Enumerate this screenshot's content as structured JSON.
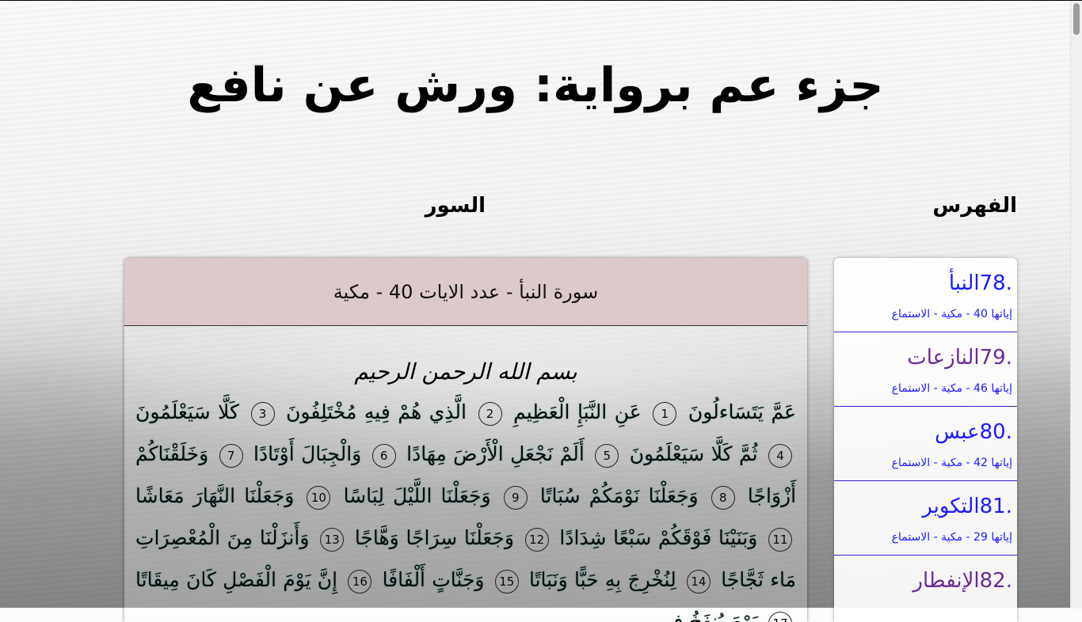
{
  "page": {
    "title": "جزء عم برواية: ورش عن نافع"
  },
  "headings": {
    "index": "الفهرس",
    "surahs": "السور"
  },
  "index": {
    "items": [
      {
        "title": ".78النبأ",
        "meta": "إياتها 40 - مكية - الاستماع",
        "visited": false
      },
      {
        "title": ".79النازعات",
        "meta": "إياتها 46 - مكية - الاستماع",
        "visited": true
      },
      {
        "title": ".80عبس",
        "meta": "إياتها 42 - مكية - الاستماع",
        "visited": false
      },
      {
        "title": ".81التكوير",
        "meta": "إياتها 29 - مكية - الاستماع",
        "visited": false
      },
      {
        "title": ".82الإنفطار",
        "meta": "",
        "visited": true
      }
    ]
  },
  "surah": {
    "header": "سورة النبأ - عدد الايات 40 - مكية",
    "basmala": "بسم الله الرحمن الرحيم",
    "verses": [
      {
        "text": "عَمَّ يَتَسَاءلُونَ",
        "num": "1"
      },
      {
        "text": "عَنِ النَّبَإِ الْعَظِيمِ",
        "num": "2"
      },
      {
        "text": "الَّذِي هُمْ فِيهِ مُخْتَلِفُونَ",
        "num": "3"
      },
      {
        "text": "كَلَّا سَيَعْلَمُونَ",
        "num": "4"
      },
      {
        "text": "ثُمَّ كَلَّا سَيَعْلَمُونَ",
        "num": "5"
      },
      {
        "text": "أَلَمْ نَجْعَلِ الْأَرْضَ مِهَادًا",
        "num": "6"
      },
      {
        "text": "وَالْجِبَالَ أَوْتَادًا",
        "num": "7"
      },
      {
        "text": "وَخَلَقْنَاكُمْ أَزْوَاجًا",
        "num": "8"
      },
      {
        "text": "وَجَعَلْنَا نَوْمَكُمْ سُبَاتًا",
        "num": "9"
      },
      {
        "text": "وَجَعَلْنَا اللَّيْلَ لِبَاسًا",
        "num": "10"
      },
      {
        "text": "وَجَعَلْنَا النَّهَارَ مَعَاشًا",
        "num": "11"
      },
      {
        "text": "وَبَنَيْنَا فَوْقَكُمْ سَبْعًا شِدَادًا",
        "num": "12"
      },
      {
        "text": "وَجَعَلْنَا سِرَاجًا وَهَّاجًا",
        "num": "13"
      },
      {
        "text": "وَأَنزَلْنَا مِنَ الْمُعْصِرَاتِ مَاء ثَجَّاجًا",
        "num": "14"
      },
      {
        "text": "لِنُخْرِجَ بِهِ حَبًّا وَنَبَاتًا",
        "num": "15"
      },
      {
        "text": "وَجَنَّاتٍ أَلْفَافًا",
        "num": "16"
      },
      {
        "text": "إِنَّ يَوْمَ الْفَصْلِ كَانَ مِيقَاتًا",
        "num": "17"
      },
      {
        "text": "يَوْمَ يُنفَخُ فِي",
        "num": ""
      }
    ]
  }
}
